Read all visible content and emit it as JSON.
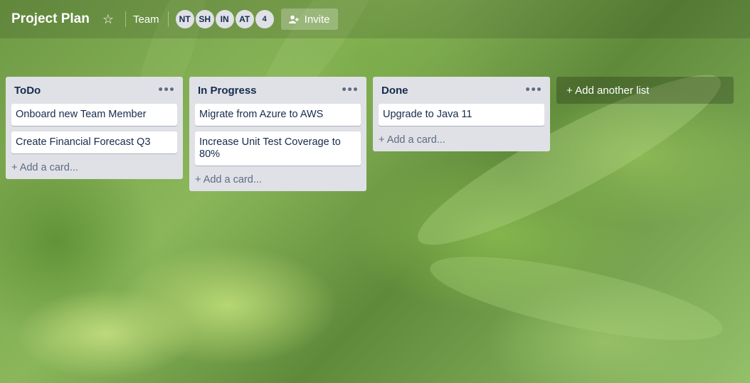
{
  "header": {
    "title": "Project Plan",
    "team_label": "Team",
    "avatars": [
      "NT",
      "SH",
      "IN",
      "AT"
    ],
    "more_count": "4",
    "invite_label": "Invite"
  },
  "lists": [
    {
      "title": "ToDo",
      "cards": [
        "Onboard new Team Member",
        "Create Financial Forecast Q3"
      ],
      "add_label": "+ Add a card..."
    },
    {
      "title": "In Progress",
      "cards": [
        "Migrate from Azure to AWS",
        "Increase Unit Test Coverage to 80%"
      ],
      "add_label": "+ Add a card..."
    },
    {
      "title": "Done",
      "cards": [
        "Upgrade to Java 11"
      ],
      "add_label": "+ Add a card..."
    }
  ],
  "add_list_label": "+ Add another list",
  "icons": {
    "star": "star-icon",
    "invite": "add-user-icon",
    "list_menu": "ellipsis-icon"
  },
  "colors": {
    "list_bg": "#dfe1e6",
    "card_bg": "#ffffff",
    "text": "#172b4d",
    "muted_text": "#5e6c84"
  }
}
